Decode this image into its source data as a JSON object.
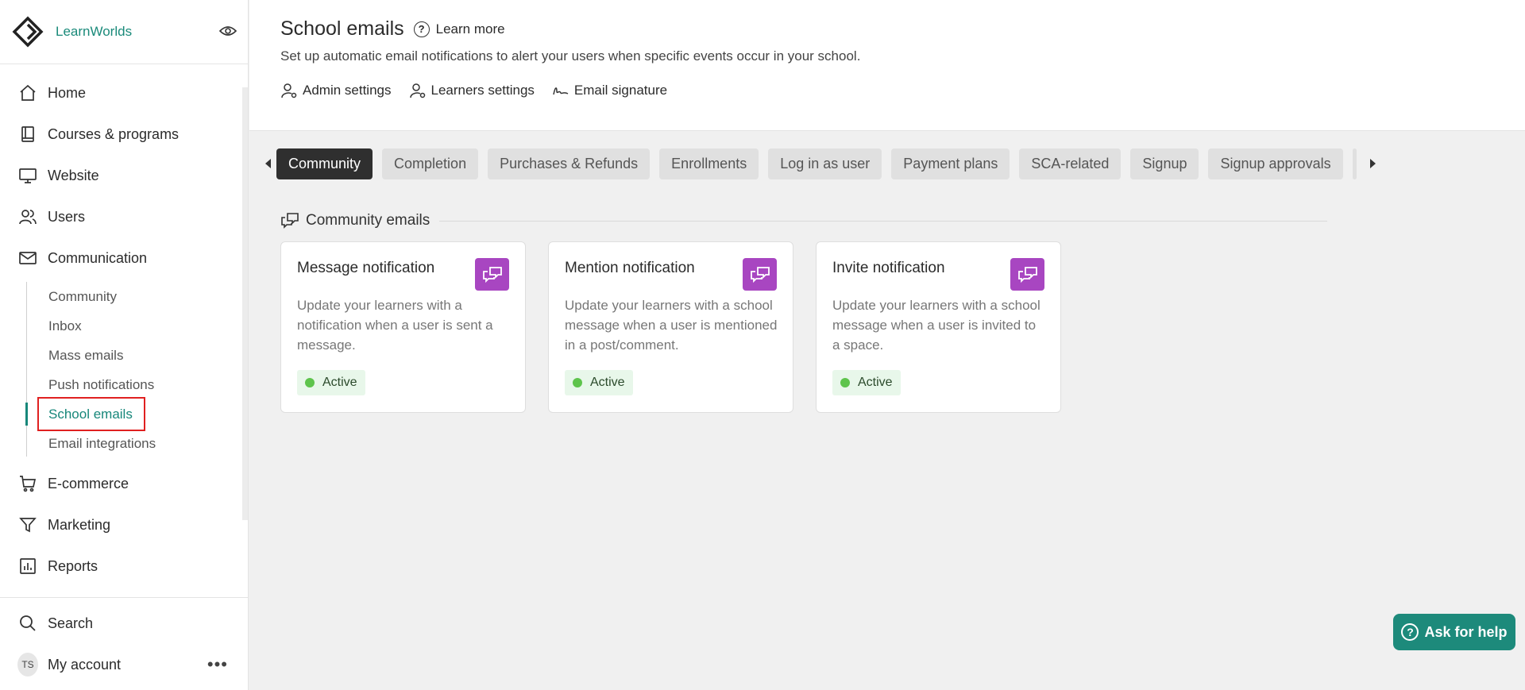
{
  "brand": {
    "name": "LearnWorlds"
  },
  "sidebar": {
    "items": [
      {
        "label": "Home",
        "icon": "home-icon"
      },
      {
        "label": "Courses & programs",
        "icon": "book-icon"
      },
      {
        "label": "Website",
        "icon": "monitor-icon"
      },
      {
        "label": "Users",
        "icon": "users-icon"
      },
      {
        "label": "Communication",
        "icon": "mail-icon"
      }
    ],
    "communication_sub": [
      "Community",
      "Inbox",
      "Mass emails",
      "Push notifications",
      "School emails",
      "Email integrations"
    ],
    "items_after": [
      {
        "label": "E-commerce",
        "icon": "cart-icon"
      },
      {
        "label": "Marketing",
        "icon": "funnel-icon"
      },
      {
        "label": "Reports",
        "icon": "chart-icon"
      }
    ],
    "bottom": {
      "search": "Search",
      "account": "My account",
      "avatar_initials": "TS"
    }
  },
  "header": {
    "title": "School emails",
    "learn_more": "Learn more",
    "description": "Set up automatic email notifications to alert your users when specific events occur in your school.",
    "links": [
      "Admin settings",
      "Learners settings",
      "Email signature"
    ]
  },
  "tabs": [
    "Community",
    "Completion",
    "Purchases & Refunds",
    "Enrollments",
    "Log in as user",
    "Payment plans",
    "SCA-related",
    "Signup",
    "Signup approvals"
  ],
  "active_tab": "Community",
  "section": {
    "title": "Community emails"
  },
  "cards": [
    {
      "title": "Message notification",
      "description": "Update your learners with a notification when a user is sent a message.",
      "status": "Active"
    },
    {
      "title": "Mention notification",
      "description": "Update your learners with a school message when a user is mentioned in a post/comment.",
      "status": "Active"
    },
    {
      "title": "Invite notification",
      "description": "Update your learners with a school message when a user is invited to a space.",
      "status": "Active"
    }
  ],
  "help_button": "Ask for help",
  "colors": {
    "accent": "#17877a",
    "card_icon": "#a846c1",
    "status_dot": "#5ec44c",
    "active_tab": "#2f2f2f"
  }
}
